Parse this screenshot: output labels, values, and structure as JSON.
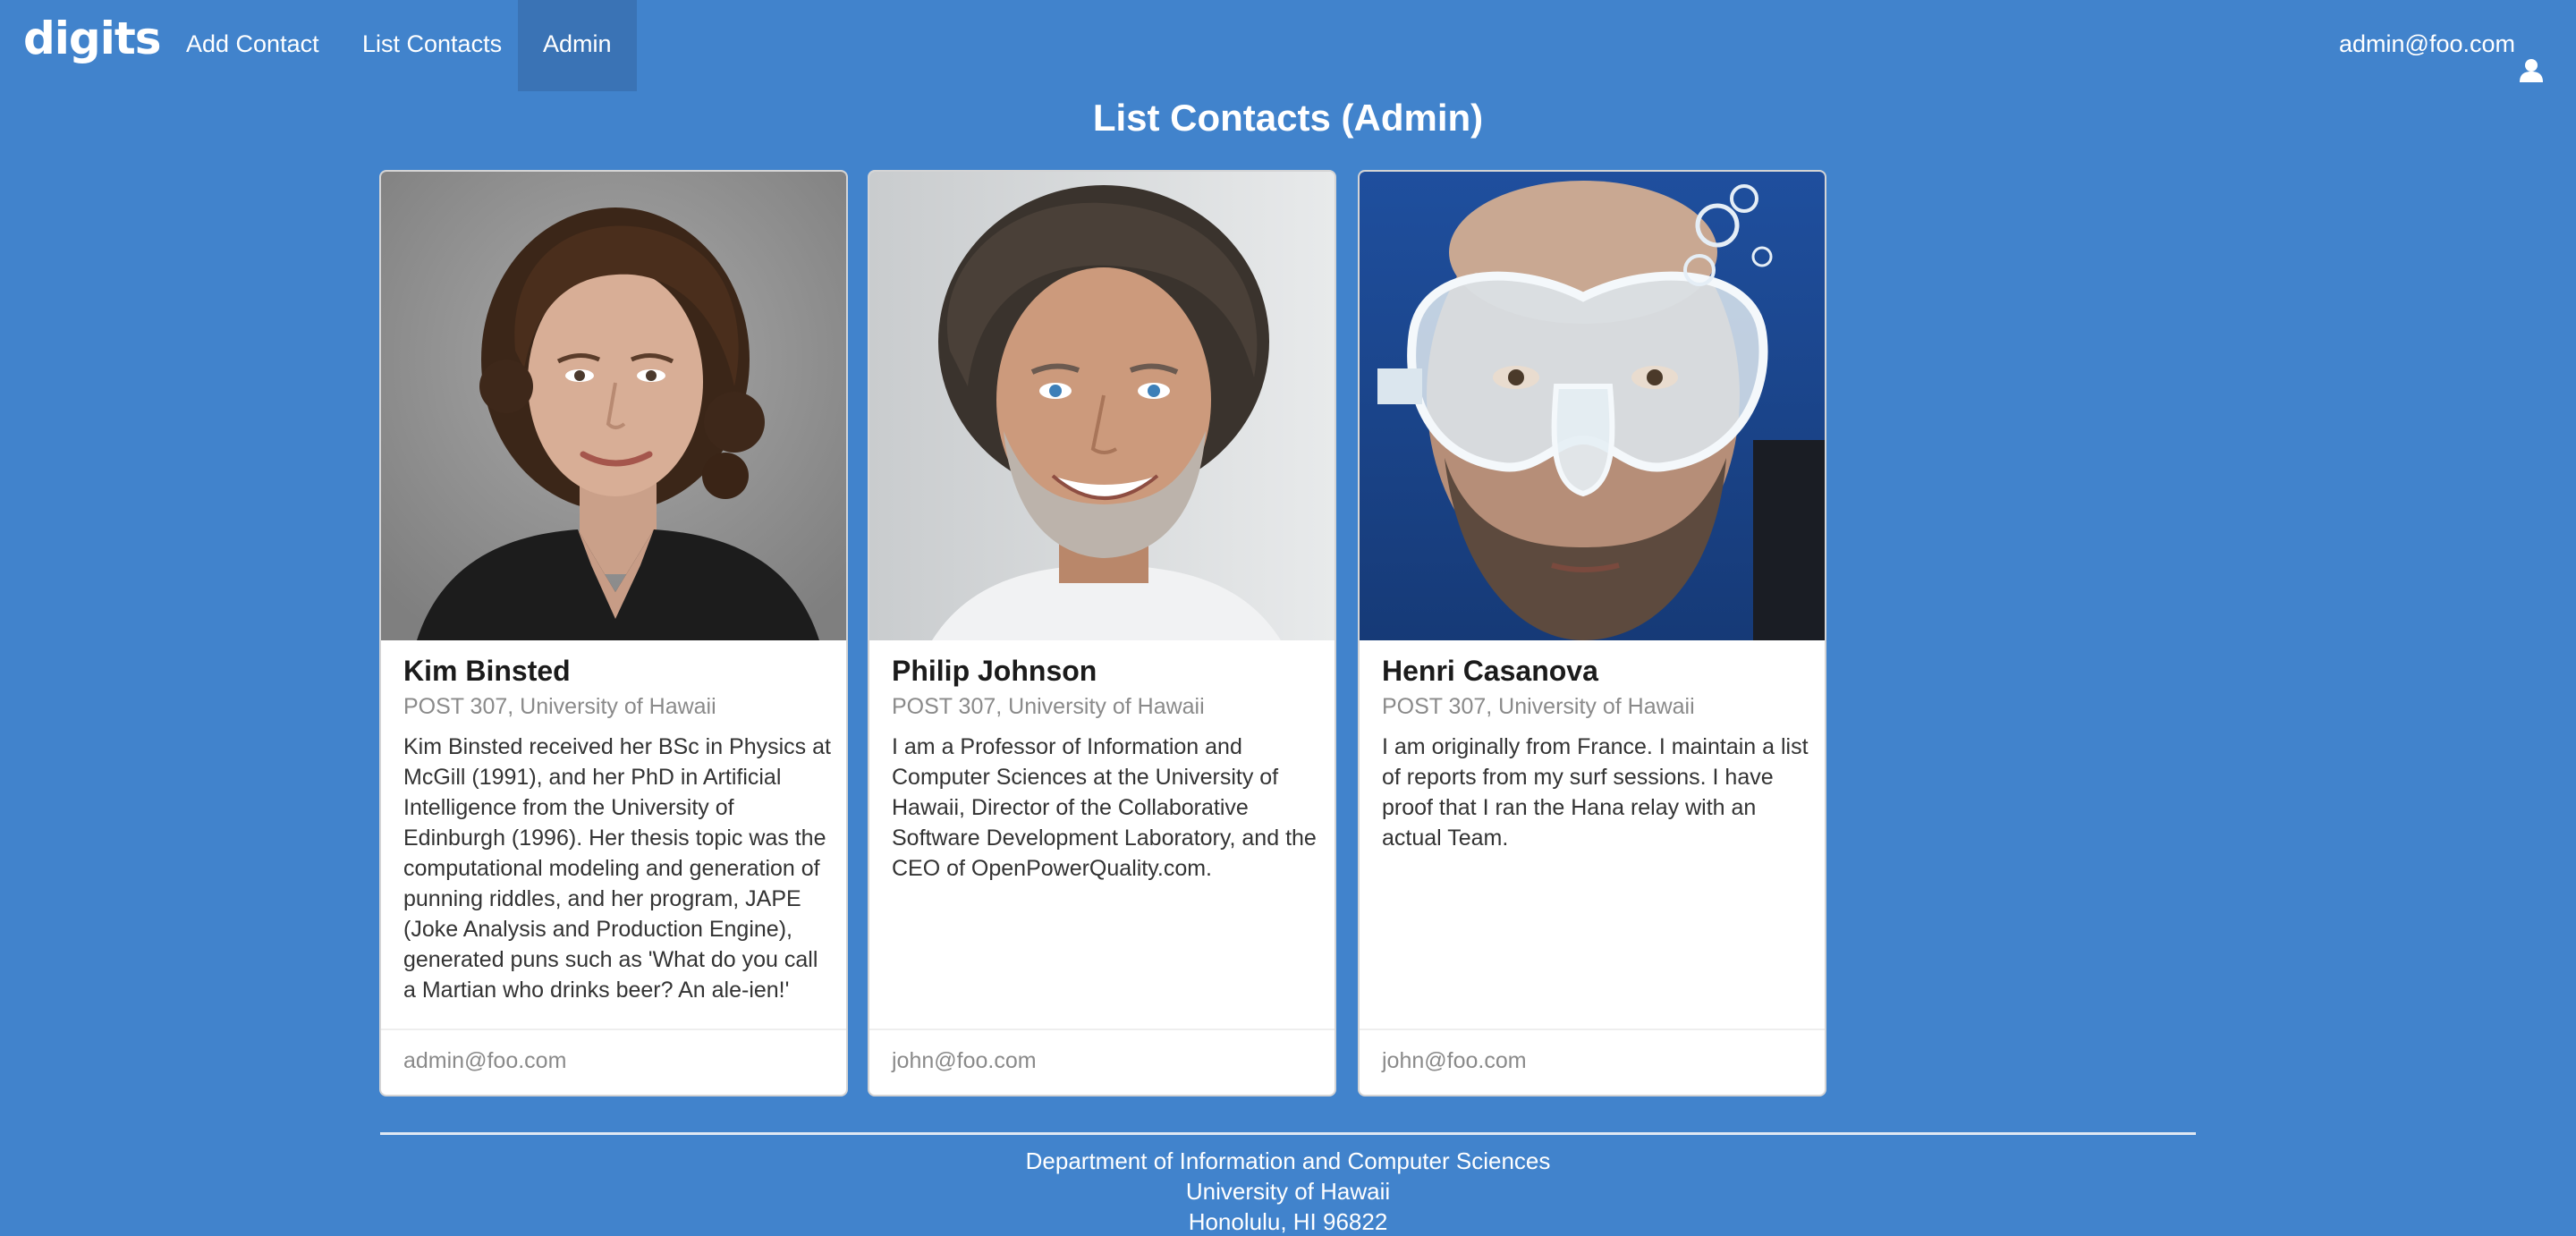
{
  "navbar": {
    "logo": "digits",
    "items": [
      {
        "label": "Add Contact"
      },
      {
        "label": "List Contacts"
      },
      {
        "label": "Admin"
      }
    ],
    "active_item": "Admin",
    "user_email": "admin@foo.com",
    "user_icon": "user-icon"
  },
  "page_title": "List Contacts (Admin)",
  "contacts": [
    {
      "name": "Kim Binsted",
      "address": "POST 307, University of Hawaii",
      "description": "Kim Binsted received her BSc in Physics at McGill (1991), and her PhD in Artificial Intelligence from the University of Edinburgh (1996). Her thesis topic was the computational modeling and generation of punning riddles, and her program, JAPE (Joke Analysis and Production Engine), generated puns such as 'What do you call a Martian who drinks beer? An ale-ien!'",
      "owner": "admin@foo.com"
    },
    {
      "name": "Philip Johnson",
      "address": "POST 307, University of Hawaii",
      "description": "I am a Professor of Information and Computer Sciences at the University of Hawaii, Director of the Collaborative Software Development Laboratory, and the CEO of OpenPowerQuality.com.",
      "owner": "john@foo.com"
    },
    {
      "name": "Henri Casanova",
      "address": "POST 307, University of Hawaii",
      "description": "I am originally from France. I maintain a list of reports from my surf sessions. I have proof that I ran the Hana relay with an actual Team.",
      "owner": "john@foo.com"
    }
  ],
  "footer": {
    "lines": [
      "Department of Information and Computer Sciences",
      "University of Hawaii",
      "Honolulu, HI 96822"
    ]
  },
  "colors": {
    "background": "#4183cc",
    "active_nav": "#3a73b5",
    "card": "#ffffff"
  }
}
